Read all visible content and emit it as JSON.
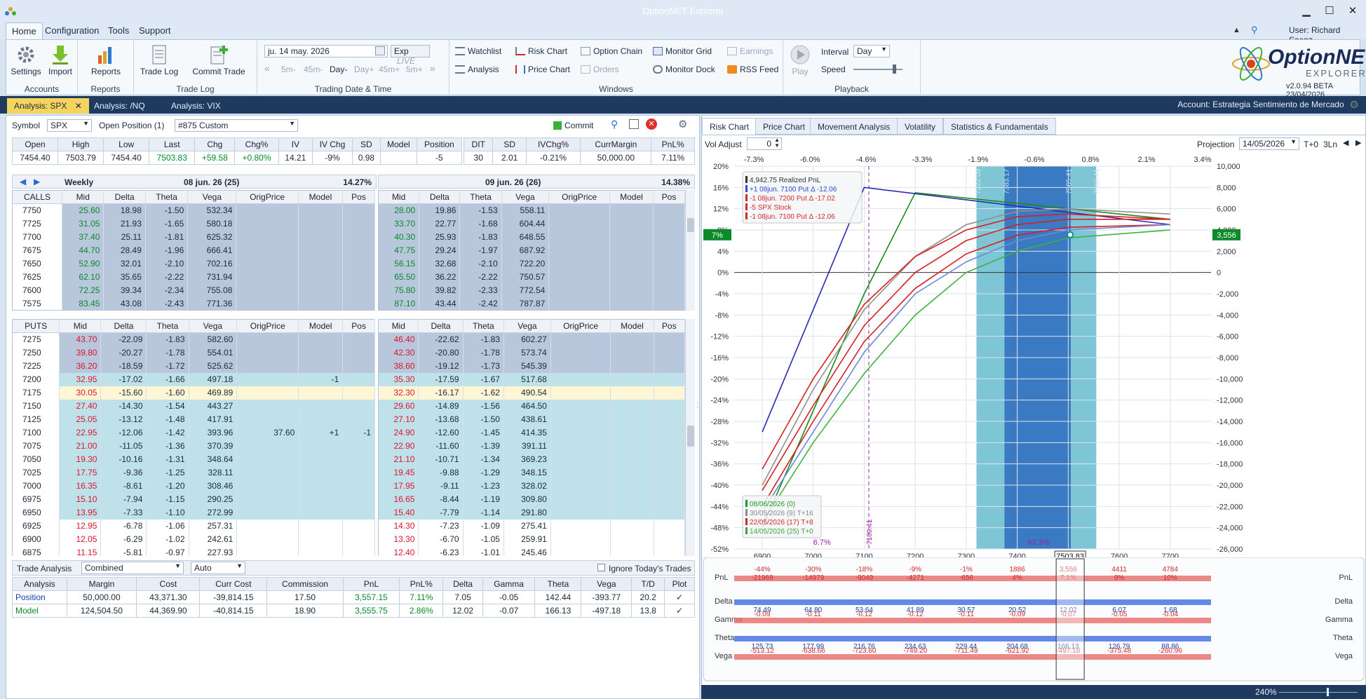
{
  "window": {
    "title": "OptionNET Explorer",
    "user": "User: Richard Saenz",
    "min": "▁",
    "max": "☐",
    "close": "✕"
  },
  "menu": [
    "Home",
    "Configuration",
    "Tools",
    "Support"
  ],
  "ribbon": {
    "accounts": {
      "caption": "Accounts",
      "settings": "Settings",
      "import": "Import"
    },
    "reports": {
      "caption": "Reports",
      "reports": "Reports"
    },
    "tradelog": {
      "caption": "Trade Log",
      "trade_log": "Trade Log",
      "commit_trade": "Commit Trade"
    },
    "trading": {
      "caption": "Trading Date & Time",
      "date": "ju. 14 may. 2026",
      "exp": "Exp",
      "live": "LIVE",
      "steps": [
        "5m-",
        "45m-",
        "Day-",
        "Day+",
        "45m+",
        "5m+"
      ]
    },
    "windows": {
      "caption": "Windows",
      "watchlist": "Watchlist",
      "risk_chart": "Risk Chart",
      "option_chain": "Option Chain",
      "monitor_grid": "Monitor Grid",
      "earnings": "Earnings",
      "analysis": "Analysis",
      "price_chart": "Price Chart",
      "orders": "Orders",
      "monitor_dock": "Monitor Dock",
      "rss_feed": "RSS Feed"
    },
    "playback": {
      "caption": "Playback",
      "play": "Play",
      "interval_label": "Interval",
      "interval": "Day",
      "speed_label": "Speed"
    },
    "brand": {
      "name": "OptionNET",
      "sub": "EXPLORER",
      "version": "v2.0.94 BETA 23/04/2026"
    }
  },
  "doc_tabs": [
    "Analysis: SPX",
    "Analysis: /NQ",
    "Analysis: VIX"
  ],
  "account": "Account: Estrategia Sentimiento de Mercado",
  "left": {
    "symbol_label": "Symbol",
    "symbol": "SPX",
    "open_pos_label": "Open Position (1)",
    "position": "#875 Custom",
    "commit": "Commit",
    "quote_headers": [
      "Open",
      "High",
      "Low",
      "Last",
      "Chg",
      "Chg%",
      "IV",
      "IV Chg",
      "SD",
      "Model",
      "Position"
    ],
    "quote_values": [
      "7454.40",
      "7503.79",
      "7454.40",
      "7503.83",
      "+59.58",
      "+0.80%",
      "14.21",
      "-9%",
      "0.98",
      "",
      "-5"
    ],
    "pos_headers": [
      "DIT",
      "SD",
      "IVChg%",
      "CurrMargin",
      "PnL%"
    ],
    "pos_values": [
      "30",
      "2.01",
      "-0.21%",
      "50,000.00",
      "7.11%"
    ],
    "exp1": {
      "label": "Weekly",
      "date": "08 jun. 26 (25)",
      "iv": "14.27%"
    },
    "exp2": {
      "date": "09 jun. 26 (26)",
      "iv": "14.38%"
    },
    "cols": [
      "Mid",
      "Delta",
      "Theta",
      "Vega",
      "OrigPrice",
      "Model",
      "Pos"
    ],
    "calls_label": "CALLS",
    "puts_label": "PUTS",
    "calls": [
      [
        "7750",
        "25.60",
        "18.98",
        "-1.50",
        "532.34",
        "28.00",
        "19.86",
        "-1.53",
        "558.11"
      ],
      [
        "7725",
        "31.05",
        "21.93",
        "-1.65",
        "580.18",
        "33.70",
        "22.77",
        "-1.68",
        "604.44"
      ],
      [
        "7700",
        "37.40",
        "25.11",
        "-1.81",
        "625.32",
        "40.30",
        "25.93",
        "-1.83",
        "648.55"
      ],
      [
        "7675",
        "44.70",
        "28.49",
        "-1.96",
        "666.41",
        "47.75",
        "29.24",
        "-1.97",
        "687.92"
      ],
      [
        "7650",
        "52.90",
        "32.01",
        "-2.10",
        "702.16",
        "56.15",
        "32.68",
        "-2.10",
        "722.20"
      ],
      [
        "7625",
        "62.10",
        "35.65",
        "-2.22",
        "731.94",
        "65.50",
        "36.22",
        "-2.22",
        "750.57"
      ],
      [
        "7600",
        "72.25",
        "39.34",
        "-2.34",
        "755.08",
        "75.80",
        "39.82",
        "-2.33",
        "772.54"
      ],
      [
        "7575",
        "83.45",
        "43.08",
        "-2.43",
        "771.36",
        "87.10",
        "43.44",
        "-2.42",
        "787.87"
      ]
    ],
    "puts": [
      [
        "7275",
        "43.70",
        "-22.09",
        "-1.83",
        "582.60",
        "",
        "",
        "",
        "46.40",
        "-22.62",
        "-1.83",
        "602.27",
        "itm"
      ],
      [
        "7250",
        "39.80",
        "-20.27",
        "-1.78",
        "554.01",
        "",
        "",
        "",
        "42.30",
        "-20.80",
        "-1.78",
        "573.74",
        "itm"
      ],
      [
        "7225",
        "36.20",
        "-18.59",
        "-1.72",
        "525.62",
        "",
        "",
        "",
        "38.60",
        "-19.12",
        "-1.73",
        "545.39",
        "itm"
      ],
      [
        "7200",
        "32.95",
        "-17.02",
        "-1.66",
        "497.18",
        "",
        "-1",
        "",
        "35.30",
        "-17.59",
        "-1.67",
        "517.68",
        "otm"
      ],
      [
        "7175",
        "30.05",
        "-15.60",
        "-1.60",
        "469.89",
        "",
        "",
        "",
        "32.30",
        "-16.17",
        "-1.62",
        "490.54",
        "sel"
      ],
      [
        "7150",
        "27.40",
        "-14.30",
        "-1.54",
        "443.27",
        "",
        "",
        "",
        "29.60",
        "-14.89",
        "-1.56",
        "464.50",
        "otm"
      ],
      [
        "7125",
        "25.05",
        "-13.12",
        "-1.48",
        "417.91",
        "",
        "",
        "",
        "27.10",
        "-13.68",
        "-1.50",
        "438.61",
        "otm"
      ],
      [
        "7100",
        "22.95",
        "-12.06",
        "-1.42",
        "393.96",
        "37.60",
        "+1",
        "-1",
        "24.90",
        "-12.60",
        "-1.45",
        "414.35",
        "otm"
      ],
      [
        "7075",
        "21.00",
        "-11.05",
        "-1.36",
        "370.39",
        "",
        "",
        "",
        "22.90",
        "-11.60",
        "-1.39",
        "391.11",
        "otm"
      ],
      [
        "7050",
        "19.30",
        "-10.16",
        "-1.31",
        "348.64",
        "",
        "",
        "",
        "21.10",
        "-10.71",
        "-1.34",
        "369.23",
        "otm"
      ],
      [
        "7025",
        "17.75",
        "-9.36",
        "-1.25",
        "328.11",
        "",
        "",
        "",
        "19.45",
        "-9.88",
        "-1.29",
        "348.15",
        "otm"
      ],
      [
        "7000",
        "16.35",
        "-8.61",
        "-1.20",
        "308.46",
        "",
        "",
        "",
        "17.95",
        "-9.11",
        "-1.23",
        "328.02",
        "otm"
      ],
      [
        "6975",
        "15.10",
        "-7.94",
        "-1.15",
        "290.25",
        "",
        "",
        "",
        "16.65",
        "-8.44",
        "-1.19",
        "309.80",
        "otm"
      ],
      [
        "6950",
        "13.95",
        "-7.33",
        "-1.10",
        "272.99",
        "",
        "",
        "",
        "15.40",
        "-7.79",
        "-1.14",
        "291.80",
        "otm"
      ],
      [
        "6925",
        "12.95",
        "-6.78",
        "-1.06",
        "257.31",
        "",
        "",
        "",
        "14.30",
        "-7.23",
        "-1.09",
        "275.41",
        "w"
      ],
      [
        "6900",
        "12.05",
        "-6.29",
        "-1.02",
        "242.61",
        "",
        "",
        "",
        "13.30",
        "-6.70",
        "-1.05",
        "259.91",
        "w"
      ],
      [
        "6875",
        "11.15",
        "-5.81",
        "-0.97",
        "227.93",
        "",
        "",
        "",
        "12.40",
        "-6.23",
        "-1.01",
        "245.46",
        "w"
      ],
      [
        "6850",
        "10.45",
        "-5.41",
        "-0.94",
        "215.64",
        "",
        "",
        "",
        "11.60",
        "-5.80",
        "-0.97",
        "232.17",
        "w"
      ],
      [
        "6825",
        "9.75",
        "-5.03",
        "-0.90",
        "203.42",
        "",
        "",
        "",
        "10.85",
        "-5.40",
        "-0.94",
        "219.51",
        "w"
      ],
      [
        "6800",
        "9.15",
        "-4.69",
        "-0.87",
        "192.41",
        "",
        "",
        "",
        "10.15",
        "-5.04",
        "-0.90",
        "207.49",
        "w"
      ],
      [
        "6775",
        "8.55",
        "-4.37",
        "-0.83",
        "181.56",
        "",
        "",
        "",
        "9.55",
        "-4.71",
        "-0.87",
        "196.69",
        "w"
      ],
      [
        "6750",
        "8.05",
        "-4.08",
        "-0.80",
        "172.01",
        "",
        "",
        "",
        "8.95",
        "-4.39",
        "-0.83",
        "185.98",
        "w"
      ]
    ],
    "trade_analysis": {
      "label": "Trade Analysis",
      "mode": "Combined",
      "auto": "Auto",
      "ignore": "Ignore Today's Trades",
      "headers": [
        "Analysis",
        "Margin",
        "Cost",
        "Curr Cost",
        "Commission",
        "PnL",
        "PnL%",
        "Delta",
        "Gamma",
        "Theta",
        "Vega",
        "T/D",
        "Plot"
      ],
      "rows": [
        [
          "Position",
          "50,000.00",
          "43,371.30",
          "-39,814.15",
          "17.50",
          "3,557.15",
          "7.11%",
          "7.05",
          "-0.05",
          "142.44",
          "-393.77",
          "20.2"
        ],
        [
          "Model",
          "124,504.50",
          "44,369.90",
          "-40,814.15",
          "18.90",
          "3,555.75",
          "2.86%",
          "12.02",
          "-0.07",
          "166.13",
          "-497.18",
          "13.8"
        ]
      ]
    }
  },
  "right": {
    "tabs": [
      "Risk Chart",
      "Price Chart",
      "Movement Analysis",
      "Volatility",
      "Statistics & Fundamentals"
    ],
    "vol_adjust_label": "Vol Adjust",
    "vol_adjust": "0",
    "projection_label": "Projection",
    "projection": "14/05/2026",
    "t0": "T+0",
    "ln": "3Ln",
    "chart_data": {
      "type": "line",
      "x_ticks": [
        6900,
        7000,
        7100,
        7200,
        7300,
        7400,
        7500,
        7600,
        7700
      ],
      "x_ticks_labels": [
        "6900",
        "7000",
        "7100",
        "7200",
        "7300",
        "7400",
        "7600",
        "7700"
      ],
      "current_price": "7503.83",
      "top_pct_ticks": [
        "-7.3%",
        "-6.0%",
        "-4.6%",
        "-3.3%",
        "-1.9%",
        "-0.6%",
        "0.8%",
        "2.1%",
        "3.4%"
      ],
      "top_current": "0.8%",
      "y_left_ticks": [
        "20%",
        "16%",
        "12%",
        "8%",
        "4%",
        "0%",
        "-4%",
        "-8%",
        "-12%",
        "-16%",
        "-20%",
        "-24%",
        "-28%",
        "-32%",
        "-36%",
        "-40%",
        "-44%",
        "-48%",
        "-52%"
      ],
      "y_right_ticks": [
        "10,000",
        "8,000",
        "6,000",
        "4,000",
        "2,000",
        "0",
        "-2,000",
        "-4,000",
        "-6,000",
        "-8,000",
        "-10,000",
        "-12,000",
        "-14,000",
        "-16,000",
        "-18,000",
        "-20,000",
        "-22,000",
        "-24,000",
        "-26,000"
      ],
      "y_left_range": [
        -52,
        20
      ],
      "y_right_range": [
        -26000,
        10000
      ],
      "left_badge": "7%",
      "right_badge": "3,556",
      "sd_lines": [
        "7222.09",
        "7383.17",
        "7565.41",
        "7566.41"
      ],
      "mean_line": "7109.41",
      "prob_low": "6.7%",
      "prob_high": "93.3%",
      "legend_top": [
        {
          "text": "4,942.75 Realized PnL",
          "color": "#333333"
        },
        {
          "text": "+1 08jun. 7100 Put Δ  -12.06",
          "color": "#2a4ad0"
        },
        {
          "text": "-1 08jun. 7200 Put Δ  -17.02",
          "color": "#d02a2a"
        },
        {
          "text": "-5 SPX Stock",
          "color": "#d02a2a"
        },
        {
          "text": "-1 08jun. 7100 Put Δ  -12.06",
          "color": "#d02a2a"
        }
      ],
      "legend_bottom": [
        {
          "text": "08/06/2026 (0)",
          "color": "#1a9a1a"
        },
        {
          "text": "30/05/2026 (9) T+16",
          "color": "#8a8a8a"
        },
        {
          "text": "22/05/2026 (17) T+8",
          "color": "#d02a2a"
        },
        {
          "text": "14/05/2026 (25) T+0",
          "color": "#3aa83a"
        }
      ],
      "series": [
        {
          "name": "08/06/2026 (0)",
          "color": "#1a8a1a",
          "x": [
            6900,
            7100,
            7200,
            7700
          ],
          "y": [
            -48,
            -4,
            15,
            10
          ]
        },
        {
          "name": "Model",
          "color": "#2a2ab0",
          "x": [
            6900,
            7100,
            7700
          ],
          "y": [
            -30,
            16,
            9
          ]
        },
        {
          "name": "30/05/2026 (9) T+16",
          "color": "#909090",
          "x": [
            6900,
            7000,
            7100,
            7200,
            7300,
            7400,
            7500,
            7700
          ],
          "y": [
            -40,
            -22,
            -7,
            3,
            9,
            11.5,
            12,
            11
          ]
        },
        {
          "name": "22/05/2026 (17) T+8",
          "color": "#d82020",
          "x": [
            6900,
            7000,
            7100,
            7200,
            7300,
            7400,
            7500,
            7700
          ],
          "y": [
            -44,
            -28,
            -13,
            -3,
            3.5,
            7,
            8.5,
            9
          ]
        },
        {
          "name": "14/05/2026 (25) T+0",
          "color": "#40b040",
          "x": [
            6900,
            7000,
            7100,
            7200,
            7300,
            7400,
            7500,
            7700
          ],
          "y": [
            -47,
            -32,
            -19,
            -8,
            0,
            4,
            6.5,
            8
          ]
        },
        {
          "name": "PnL +8",
          "color": "#d82020",
          "x": [
            6900,
            7000,
            7100,
            7200,
            7300,
            7400,
            7500,
            7700
          ],
          "y": [
            -37,
            -20,
            -6,
            3,
            8,
            10.5,
            11,
            10
          ]
        },
        {
          "name": "PnL mid",
          "color": "#d82020",
          "x": [
            6900,
            7000,
            7100,
            7200,
            7300,
            7400,
            7500,
            7700
          ],
          "y": [
            -41,
            -25,
            -10,
            0,
            6,
            9,
            10,
            10
          ]
        },
        {
          "name": "PnL +16b",
          "color": "#6a8ad8",
          "x": [
            6900,
            7000,
            7100,
            7200,
            7300,
            7400,
            7500,
            7700
          ],
          "y": [
            -45,
            -30,
            -15,
            -4,
            2,
            6,
            8,
            9
          ]
        }
      ]
    },
    "greeks": {
      "rows": [
        {
          "label": "PnL",
          "color": "#e86a6a",
          "values": [
            "-44%",
            "-30%",
            "-18%",
            "-9%",
            "-1%",
            "1886",
            "3,556",
            "4411",
            "4784"
          ],
          "values2": [
            "-21969",
            "-14979",
            "-9049",
            "-4271",
            "-656",
            "4%",
            "7.1%",
            "9%",
            "10%"
          ]
        },
        {
          "label": "Delta",
          "color": "#3e6ce0",
          "values": [
            "74.49",
            "64.80",
            "53.64",
            "41.89",
            "30.57",
            "20.52",
            "12.02",
            "6.07",
            "1.68"
          ]
        },
        {
          "label": "Gamma",
          "color": "#e86a6a",
          "values": [
            "-0.09",
            "-0.11",
            "-0.12",
            "-0.12",
            "-0.11",
            "-0.09",
            "-0.07",
            "-0.05",
            "-0.04"
          ]
        },
        {
          "label": "Theta",
          "color": "#3e6ce0",
          "values": [
            "125.73",
            "177.99",
            "216.76",
            "234.63",
            "229.44",
            "204.68",
            "166.13",
            "126.79",
            "88.86"
          ]
        },
        {
          "label": "Vega",
          "color": "#e86a6a",
          "values": [
            "-513.12",
            "-638.66",
            "-723.60",
            "-749.20",
            "-711.49",
            "-621.92",
            "-497.18",
            "-375.48",
            "-260.96"
          ]
        }
      ]
    },
    "zoom": "240%"
  }
}
